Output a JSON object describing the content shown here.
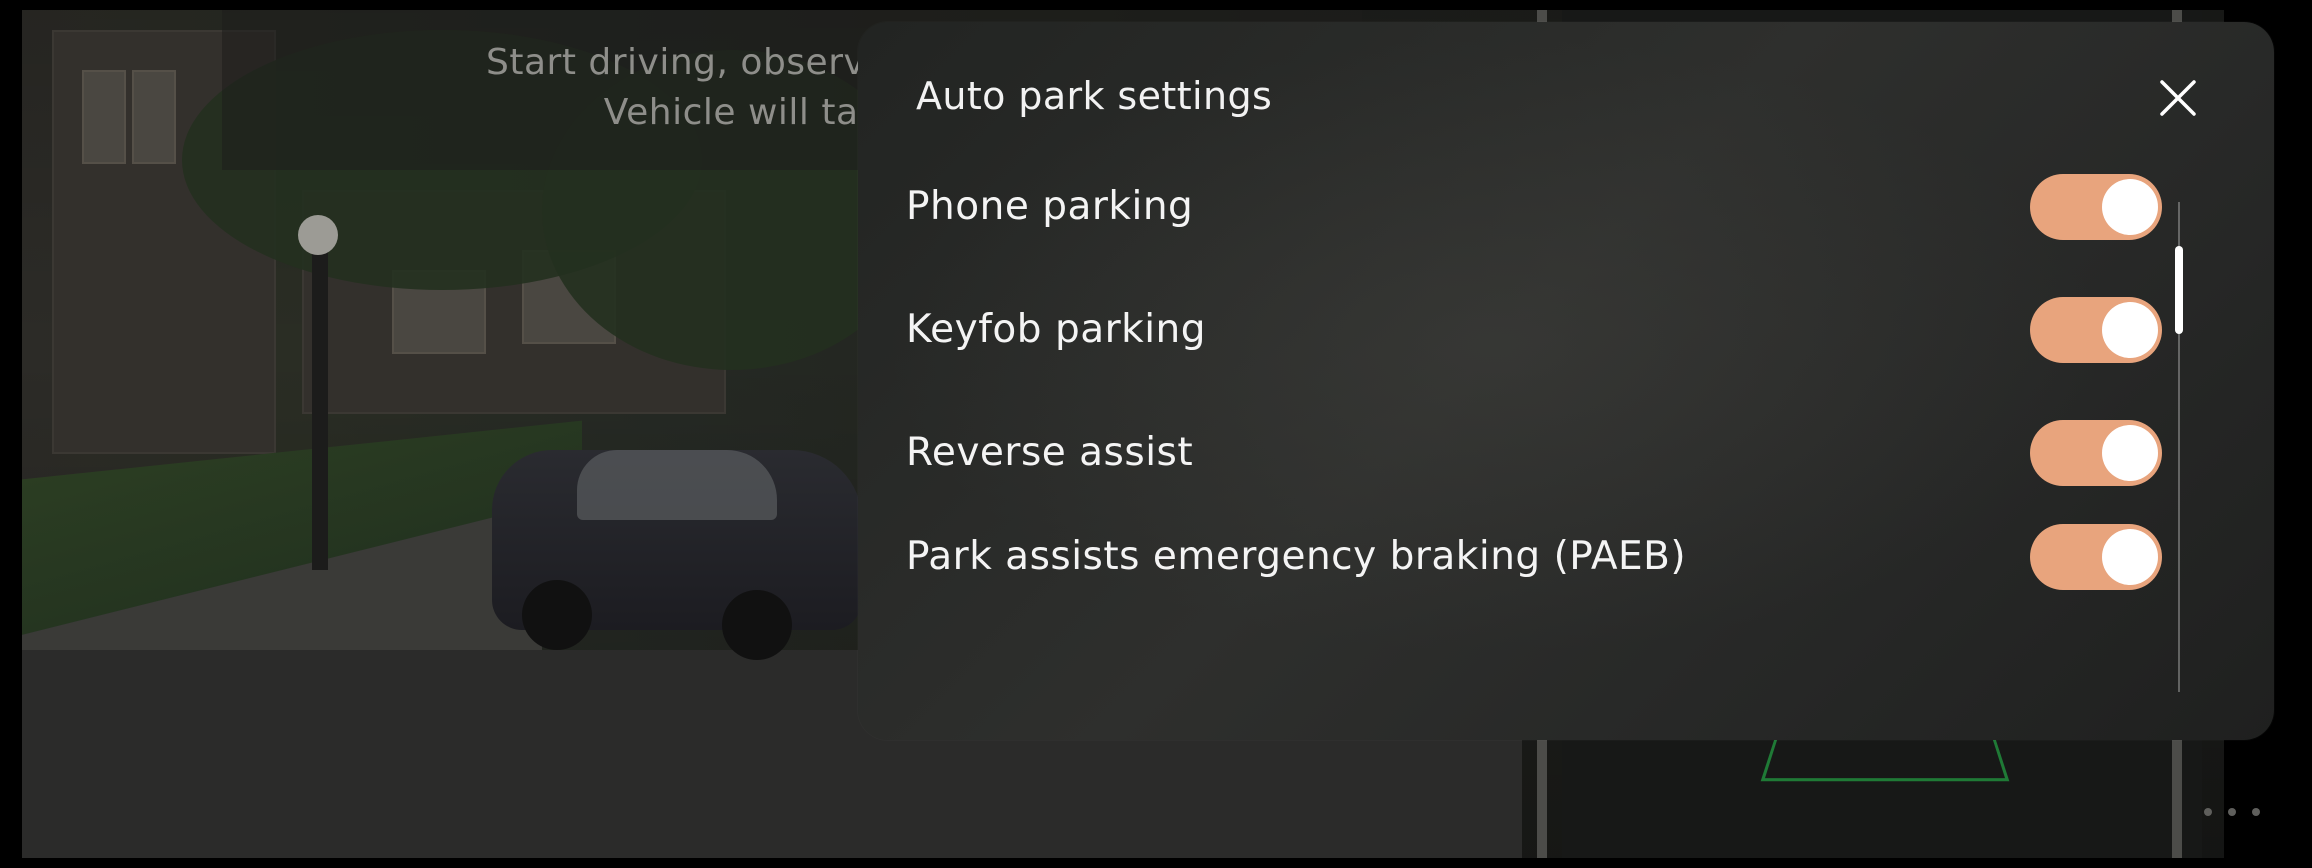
{
  "instruction_banner": {
    "line1": "Start driving, observe surroundin",
    "line2": "Vehicle will take ove"
  },
  "dialog": {
    "title": "Auto park settings",
    "close_icon": "close-icon",
    "settings": [
      {
        "label": "Phone parking",
        "enabled": true
      },
      {
        "label": "Keyfob parking",
        "enabled": true
      },
      {
        "label": "Reverse assist",
        "enabled": true
      },
      {
        "label": "Park assists emergency braking (PAEB)",
        "enabled": true
      }
    ]
  },
  "more_menu_icon": "more-horizontal-icon",
  "colors": {
    "toggle_on": "#e8a47d",
    "toggle_knob": "#ffffff",
    "dialog_background": "#2a2b29",
    "text_primary": "#f4f4f4",
    "banner_text": "#8e8e8a"
  }
}
